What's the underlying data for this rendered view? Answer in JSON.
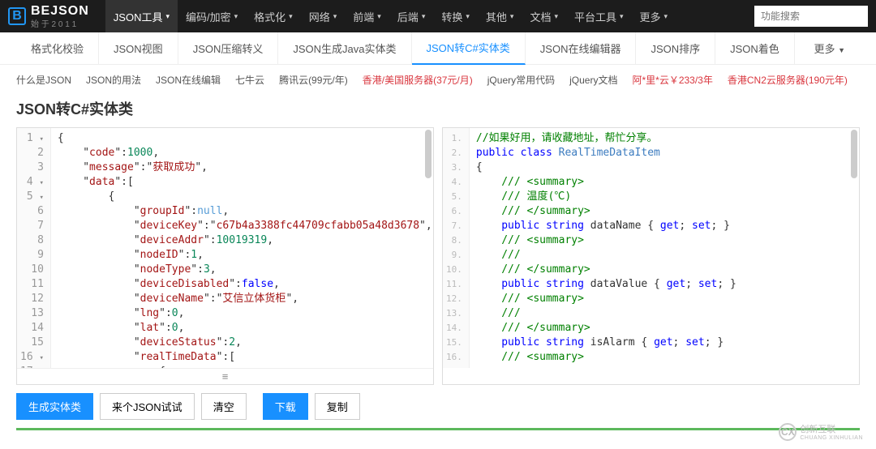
{
  "logo": {
    "badge": "B",
    "text": "BEJSON",
    "sub": "始 于 2 0 1 1"
  },
  "topnav": {
    "items": [
      "JSON工具",
      "编码/加密",
      "格式化",
      "网络",
      "前端",
      "后端",
      "转换",
      "其他",
      "文档",
      "平台工具",
      "更多"
    ],
    "active_index": 0
  },
  "search": {
    "placeholder": "功能搜索"
  },
  "subnav": {
    "items": [
      "格式化校验",
      "JSON视图",
      "JSON压缩转义",
      "JSON生成Java实体类",
      "JSON转C#实体类",
      "JSON在线编辑器",
      "JSON排序",
      "JSON着色"
    ],
    "active_index": 4,
    "more": "更多"
  },
  "links": [
    {
      "text": "什么是JSON",
      "red": false
    },
    {
      "text": "JSON的用法",
      "red": false
    },
    {
      "text": "JSON在线编辑",
      "red": false
    },
    {
      "text": "七牛云",
      "red": false
    },
    {
      "text": "腾讯云(99元/年)",
      "red": false
    },
    {
      "text": "香港/美国服务器(37元/月)",
      "red": true
    },
    {
      "text": "jQuery常用代码",
      "red": false
    },
    {
      "text": "jQuery文档",
      "red": false
    },
    {
      "text": "阿*里*云￥233/3年",
      "red": true
    },
    {
      "text": "香港CN2云服务器(190元年)",
      "red": true
    }
  ],
  "page_title": "JSON转C#实体类",
  "left_editor": {
    "tokens": [
      [
        [
          "punct",
          "{"
        ]
      ],
      [
        [
          "punct",
          "    \""
        ],
        [
          "key",
          "code"
        ],
        [
          "punct",
          "\":"
        ],
        [
          "num",
          "1000"
        ],
        [
          "punct",
          ","
        ]
      ],
      [
        [
          "punct",
          "    \""
        ],
        [
          "key",
          "message"
        ],
        [
          "punct",
          "\":\""
        ],
        [
          "str",
          "获取成功"
        ],
        [
          "punct",
          "\","
        ]
      ],
      [
        [
          "punct",
          "    \""
        ],
        [
          "key",
          "data"
        ],
        [
          "punct",
          "\":["
        ]
      ],
      [
        [
          "punct",
          "        {"
        ]
      ],
      [
        [
          "punct",
          "            \""
        ],
        [
          "key",
          "groupId"
        ],
        [
          "punct",
          "\":"
        ],
        [
          "null",
          "null"
        ],
        [
          "punct",
          ","
        ]
      ],
      [
        [
          "punct",
          "            \""
        ],
        [
          "key",
          "deviceKey"
        ],
        [
          "punct",
          "\":\""
        ],
        [
          "str",
          "c67b4a3388fc44709cfabb05a48d3678"
        ],
        [
          "punct",
          "\","
        ]
      ],
      [
        [
          "punct",
          "            \""
        ],
        [
          "key",
          "deviceAddr"
        ],
        [
          "punct",
          "\":"
        ],
        [
          "num",
          "10019319"
        ],
        [
          "punct",
          ","
        ]
      ],
      [
        [
          "punct",
          "            \""
        ],
        [
          "key",
          "nodeID"
        ],
        [
          "punct",
          "\":"
        ],
        [
          "num",
          "1"
        ],
        [
          "punct",
          ","
        ]
      ],
      [
        [
          "punct",
          "            \""
        ],
        [
          "key",
          "nodeType"
        ],
        [
          "punct",
          "\":"
        ],
        [
          "num",
          "3"
        ],
        [
          "punct",
          ","
        ]
      ],
      [
        [
          "punct",
          "            \""
        ],
        [
          "key",
          "deviceDisabled"
        ],
        [
          "punct",
          "\":"
        ],
        [
          "bool",
          "false"
        ],
        [
          "punct",
          ","
        ]
      ],
      [
        [
          "punct",
          "            \""
        ],
        [
          "key",
          "deviceName"
        ],
        [
          "punct",
          "\":\""
        ],
        [
          "str",
          "艾信立体货柜"
        ],
        [
          "punct",
          "\","
        ]
      ],
      [
        [
          "punct",
          "            \""
        ],
        [
          "key",
          "lng"
        ],
        [
          "punct",
          "\":"
        ],
        [
          "num",
          "0"
        ],
        [
          "punct",
          ","
        ]
      ],
      [
        [
          "punct",
          "            \""
        ],
        [
          "key",
          "lat"
        ],
        [
          "punct",
          "\":"
        ],
        [
          "num",
          "0"
        ],
        [
          "punct",
          ","
        ]
      ],
      [
        [
          "punct",
          "            \""
        ],
        [
          "key",
          "deviceStatus"
        ],
        [
          "punct",
          "\":"
        ],
        [
          "num",
          "2"
        ],
        [
          "punct",
          ","
        ]
      ],
      [
        [
          "punct",
          "            \""
        ],
        [
          "key",
          "realTimeData"
        ],
        [
          "punct",
          "\":["
        ]
      ],
      [
        [
          "punct",
          "                {"
        ]
      ]
    ],
    "handle": "≡"
  },
  "right_editor": {
    "tokens": [
      [
        [
          "comment",
          "//如果好用，请收藏地址，帮忙分享。"
        ]
      ],
      [
        [
          "kw",
          "public"
        ],
        [
          "punct",
          " "
        ],
        [
          "kw",
          "class"
        ],
        [
          "punct",
          " "
        ],
        [
          "kw2",
          "RealTimeDataItem"
        ]
      ],
      [
        [
          "punct",
          "{"
        ]
      ],
      [
        [
          "punct",
          "    "
        ],
        [
          "comment",
          "/// <summary>"
        ]
      ],
      [
        [
          "punct",
          "    "
        ],
        [
          "comment",
          "/// 温度(℃)"
        ]
      ],
      [
        [
          "punct",
          "    "
        ],
        [
          "comment",
          "/// </summary>"
        ]
      ],
      [
        [
          "punct",
          "    "
        ],
        [
          "kw",
          "public"
        ],
        [
          "punct",
          " "
        ],
        [
          "kw",
          "string"
        ],
        [
          "punct",
          " "
        ],
        [
          "ident",
          "dataName"
        ],
        [
          "punct",
          " { "
        ],
        [
          "kw",
          "get"
        ],
        [
          "punct",
          "; "
        ],
        [
          "kw",
          "set"
        ],
        [
          "punct",
          "; }"
        ]
      ],
      [
        [
          "punct",
          "    "
        ],
        [
          "comment",
          "/// <summary>"
        ]
      ],
      [
        [
          "punct",
          "    "
        ],
        [
          "comment",
          "/// "
        ]
      ],
      [
        [
          "punct",
          "    "
        ],
        [
          "comment",
          "/// </summary>"
        ]
      ],
      [
        [
          "punct",
          "    "
        ],
        [
          "kw",
          "public"
        ],
        [
          "punct",
          " "
        ],
        [
          "kw",
          "string"
        ],
        [
          "punct",
          " "
        ],
        [
          "ident",
          "dataValue"
        ],
        [
          "punct",
          " { "
        ],
        [
          "kw",
          "get"
        ],
        [
          "punct",
          "; "
        ],
        [
          "kw",
          "set"
        ],
        [
          "punct",
          "; }"
        ]
      ],
      [
        [
          "punct",
          "    "
        ],
        [
          "comment",
          "/// <summary>"
        ]
      ],
      [
        [
          "punct",
          "    "
        ],
        [
          "comment",
          "/// "
        ]
      ],
      [
        [
          "punct",
          "    "
        ],
        [
          "comment",
          "/// </summary>"
        ]
      ],
      [
        [
          "punct",
          "    "
        ],
        [
          "kw",
          "public"
        ],
        [
          "punct",
          " "
        ],
        [
          "kw",
          "string"
        ],
        [
          "punct",
          " "
        ],
        [
          "ident",
          "isAlarm"
        ],
        [
          "punct",
          " { "
        ],
        [
          "kw",
          "get"
        ],
        [
          "punct",
          "; "
        ],
        [
          "kw",
          "set"
        ],
        [
          "punct",
          "; }"
        ]
      ],
      [
        [
          "punct",
          "    "
        ],
        [
          "comment",
          "/// <summary>"
        ]
      ]
    ]
  },
  "buttons": {
    "generate": "生成实体类",
    "sample": "来个JSON试试",
    "clear": "清空",
    "download": "下载",
    "copy": "复制"
  },
  "watermark": {
    "badge": "CX",
    "text": "创新互联",
    "sub": "CHUANG XINHULIAN"
  }
}
